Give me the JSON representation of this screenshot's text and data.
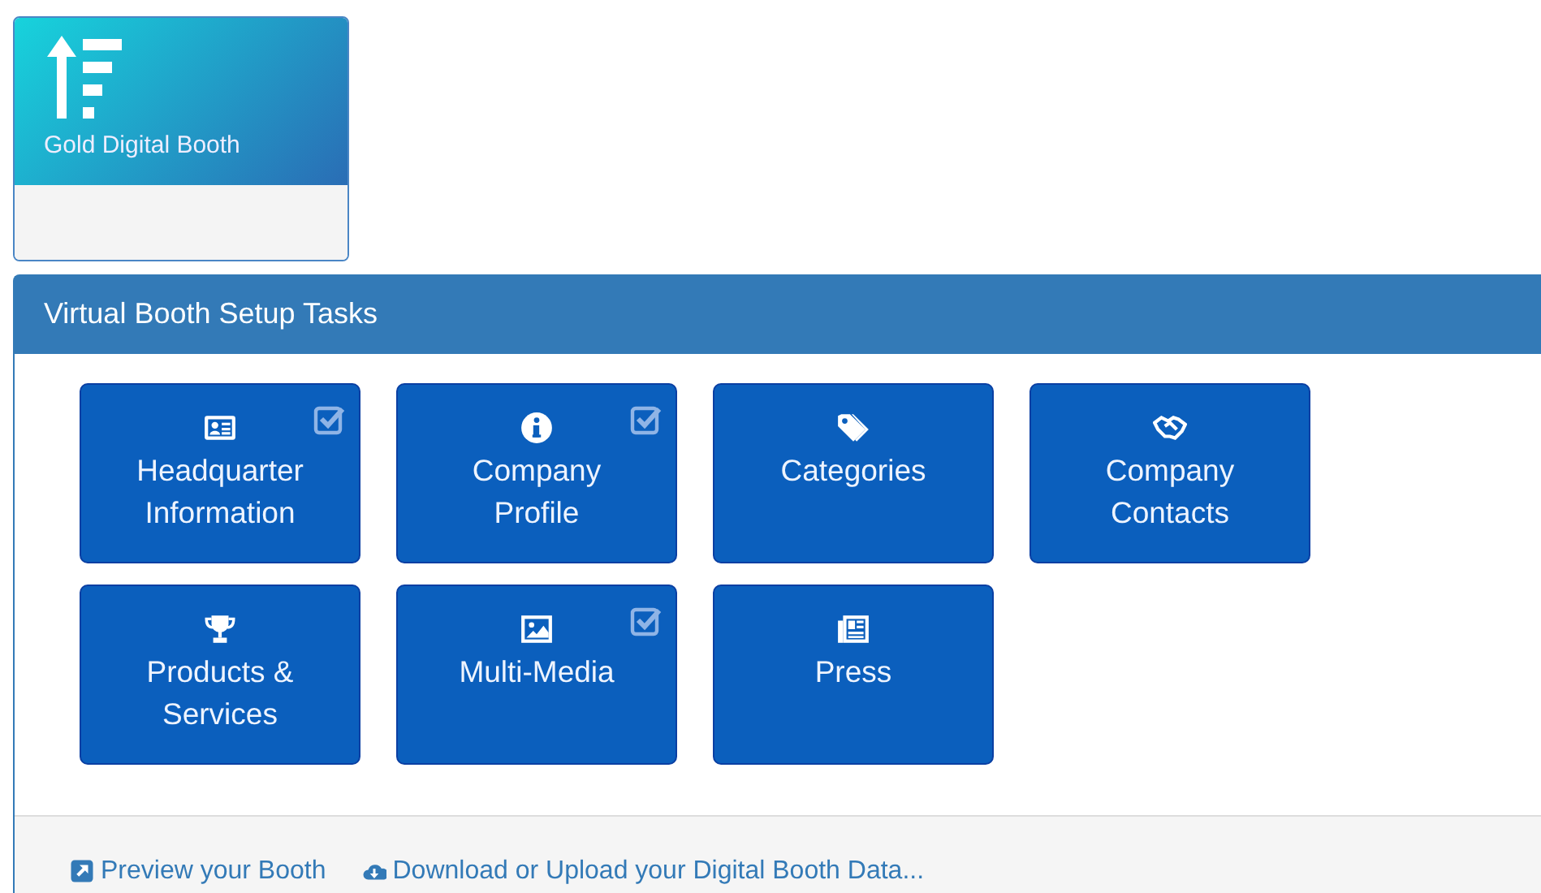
{
  "tier": {
    "label": "Gold Digital Booth"
  },
  "panel": {
    "title": "Virtual Booth Setup Tasks",
    "tasks": [
      {
        "label": "Headquarter Information",
        "checked": true
      },
      {
        "label": "Company Profile",
        "checked": true
      },
      {
        "label": "Categories",
        "checked": false
      },
      {
        "label": "Company Contacts",
        "checked": false
      },
      {
        "label": "Products & Services",
        "checked": false
      },
      {
        "label": "Multi-Media",
        "checked": true
      },
      {
        "label": "Press",
        "checked": false
      }
    ],
    "links": [
      {
        "label": "Preview your Booth"
      },
      {
        "label": "Download or Upload your Digital Booth Data..."
      }
    ]
  }
}
